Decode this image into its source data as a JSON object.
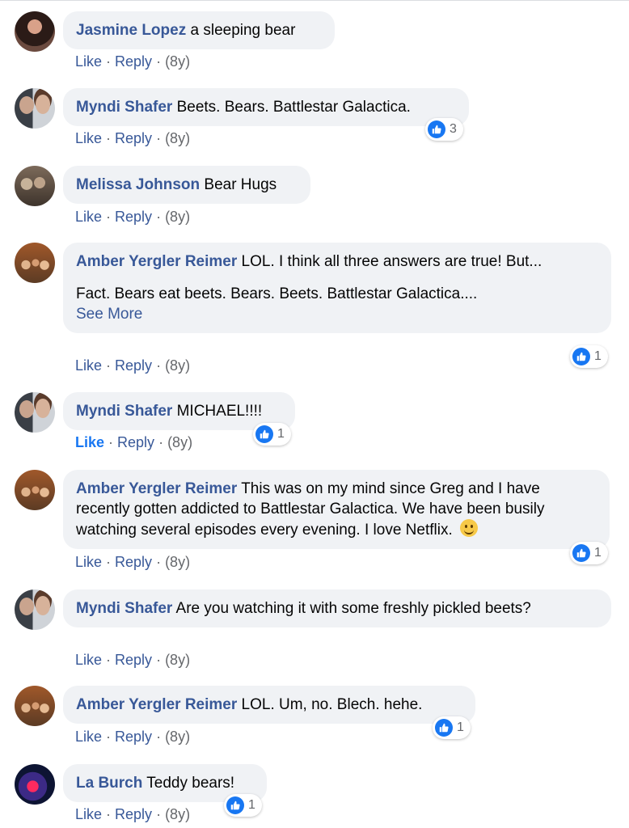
{
  "comments": [
    {
      "author": "Jasmine Lopez",
      "text": "a sleeping bear",
      "like": "Like",
      "reply": "Reply",
      "sep": "·",
      "time": "(8y)",
      "reactions": null
    },
    {
      "author": "Myndi Shafer",
      "text": "Beets. Bears. Battlestar Galactica.",
      "like": "Like",
      "reply": "Reply",
      "sep": "·",
      "time": "(8y)",
      "reactions": "3"
    },
    {
      "author": "Melissa Johnson",
      "text": "Bear Hugs",
      "like": "Like",
      "reply": "Reply",
      "sep": "·",
      "time": "(8y)",
      "reactions": null
    },
    {
      "author": "Amber Yergler Reimer",
      "text": "LOL. I think all three answers are true! But...",
      "text2": "Fact. Bears eat beets. Bears. Beets. Battlestar Galactica....",
      "see_more": "See More",
      "like": "Like",
      "reply": "Reply",
      "sep": "·",
      "time": "(8y)",
      "reactions": "1"
    },
    {
      "author": "Myndi Shafer",
      "text": "MICHAEL!!!!",
      "like": "Like",
      "reply": "Reply",
      "sep": "·",
      "time": "(8y)",
      "reactions": "1",
      "liked": true
    },
    {
      "author": "Amber Yergler Reimer",
      "text": "This was on my mind since Greg and I have recently gotten addicted to Battlestar Galactica. We have been busily watching several episodes every evening. I love Netflix.",
      "emoji": "smiley-emoji",
      "like": "Like",
      "reply": "Reply",
      "sep": "·",
      "time": "(8y)",
      "reactions": "1"
    },
    {
      "author": "Myndi Shafer",
      "text": "Are you watching it with some freshly pickled beets?",
      "like": "Like",
      "reply": "Reply",
      "sep": "·",
      "time": "(8y)",
      "reactions": null
    },
    {
      "author": "Amber Yergler Reimer",
      "text": "LOL. Um, no. Blech. hehe.",
      "like": "Like",
      "reply": "Reply",
      "sep": "·",
      "time": "(8y)",
      "reactions": "1"
    },
    {
      "author": "La Burch",
      "text": "Teddy bears!",
      "like": "Like",
      "reply": "Reply",
      "sep": "·",
      "time": "(8y)",
      "reactions": "1"
    }
  ],
  "colors": {
    "link": "#385898",
    "bubble": "#f0f2f5",
    "like_blue": "#1877f2",
    "meta": "#65676b"
  },
  "icons": {
    "reaction": "thumbs-up-icon"
  }
}
